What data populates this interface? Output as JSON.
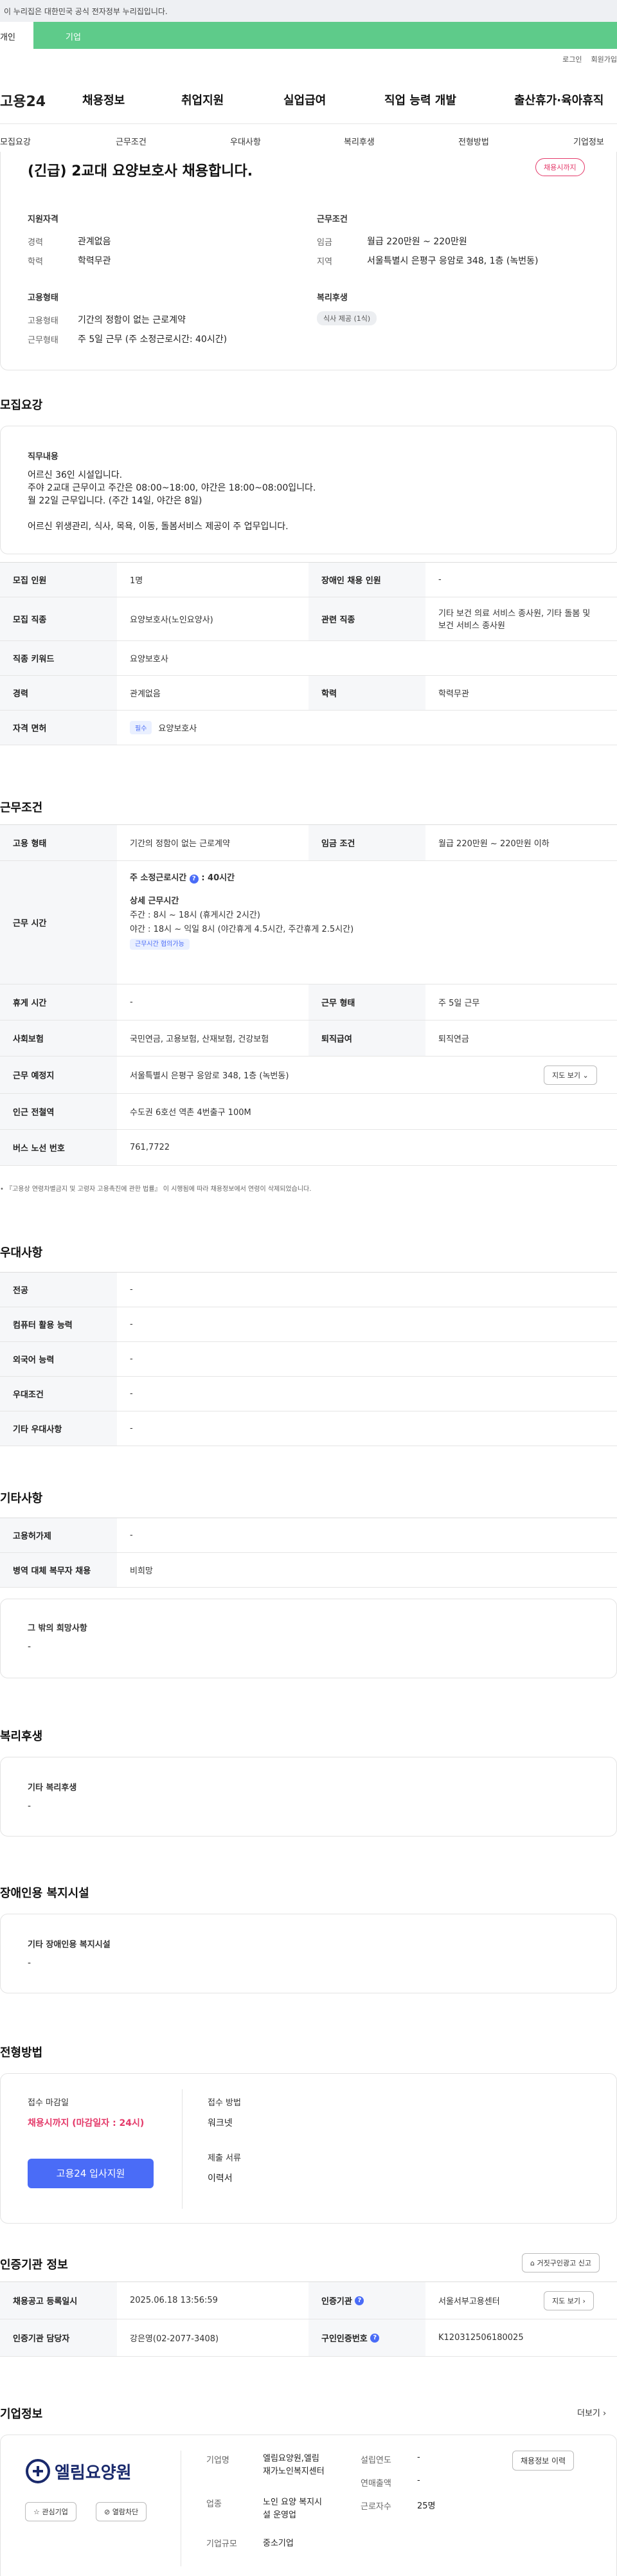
{
  "gov_banner": "이 누리집은 대한민국 공식 전자정부 누리집입니다.",
  "top_tabs": [
    "개인",
    "기업"
  ],
  "util": [
    "로그인",
    "회원가입"
  ],
  "logo": "고용24",
  "gnb": [
    "채용정보",
    "취업지원",
    "실업급여",
    "직업 능력 개발",
    "출산휴가·육아휴직"
  ],
  "subnav": [
    "모집요강",
    "근무조건",
    "우대사항",
    "복리후생",
    "전형방법",
    "기업정보"
  ],
  "summary": {
    "title": "(긴급) 2교대 요양보호사 채용합니다.",
    "deadline_badge": "채용시까지",
    "qual_title": "지원자격",
    "career_k": "경력",
    "career_v": "관계없음",
    "edu_k": "학력",
    "edu_v": "학력무관",
    "cond_title": "근무조건",
    "wage_k": "임금",
    "wage_v": "월급 220만원 ~ 220만원",
    "area_k": "지역",
    "area_v": "서울특별시 은평구 응암로 348, 1층 (녹번동)",
    "emp_title": "고용형태",
    "type_k": "고용형태",
    "type_v": "기간의 정함이 없는 근로계약",
    "work_k": "근무형태",
    "work_v": "주 5일 근무 (주 소정근로시간: 40시간)",
    "welfare_title": "복리후생",
    "welfare_tag": "식사 제공 (1식)"
  },
  "recruit": {
    "heading": "모집요강",
    "duty_title": "직무내용",
    "duty_lines": [
      "어르신 36인 시설입니다.",
      "주야 2교대 근무이고 주간은 08:00~18:00, 야간은 18:00~08:00입니다.",
      "월 22일 근무입니다. (주간 14일, 야간은 8일)",
      "",
      "어르신 위생관리, 식사, 목욕, 이동, 돌봄서비스 제공이 주 업무입니다."
    ],
    "count_k": "모집 인원",
    "count_v": "1명",
    "dis_k": "장애인 채용 인원",
    "dis_v": "-",
    "job_k": "모집 직종",
    "job_v": "요양보호사(노인요양사)",
    "rel_k": "관련 직종",
    "rel_v1": "기타 보건 의료 서비스 종사원, 기타 돌봄 및",
    "rel_v2": "보건 서비스 종사원",
    "kw_k": "직종 키워드",
    "kw_v": "요양보호사",
    "career_k": "경력",
    "career_v": "관계없음",
    "edu_k": "학력",
    "edu_v": "학력무관",
    "lic_k": "자격 면허",
    "lic_tag": "필수",
    "lic_v": "요양보호사"
  },
  "conditions": {
    "heading": "근무조건",
    "type_k": "고용 형태",
    "type_v": "기간의 정함이 없는 근로계약",
    "wage_k": "임금 조건",
    "wage_v": "월급 220만원 ~ 220만원 이하",
    "time_k": "근무 시간",
    "time_main_a": "주 소정근로시간",
    "time_main_b": ": 40시간",
    "detail_title": "상세 근무시간",
    "day": "주간 : 8시 ~ 18시 (휴게시간 2시간)",
    "night": "야간 : 18시 ~ 익일 8시 (야간휴게 4.5시간, 주간휴게 2.5시간)",
    "nego_tag": "근무시간 협의가능",
    "rest_k": "휴게 시간",
    "rest_v": "-",
    "form_k": "근무 형태",
    "form_v": "주 5일 근무",
    "ins_k": "사회보험",
    "ins_v": "국민연금, 고용보험, 산재보험, 건강보험",
    "ret_k": "퇴직급여",
    "ret_v": "퇴직연금",
    "place_k": "근무 예정지",
    "place_v": "서울특별시 은평구 응암로 348, 1층 (녹번동)",
    "map_btn": "지도 보기",
    "sub_k": "인근 전철역",
    "sub_v": "수도권 6호선 역촌 4번출구 100M",
    "bus_k": "버스 노선 번호",
    "bus_v": "761,7722",
    "note": "『고용상 연령차별금지 및 고령자 고용촉진에 관한 법률』 이 시행됨에 따라 채용정보에서 연령이 삭제되었습니다."
  },
  "pref": {
    "heading": "우대사항",
    "rows": [
      {
        "k": "전공",
        "v": "-"
      },
      {
        "k": "컴퓨터 활용 능력",
        "v": "-"
      },
      {
        "k": "외국어 능력",
        "v": "-"
      },
      {
        "k": "우대조건",
        "v": "-"
      },
      {
        "k": "기타 우대사항",
        "v": "-"
      }
    ]
  },
  "etc": {
    "heading": "기타사항",
    "rows": [
      {
        "k": "고용허가제",
        "v": "-"
      },
      {
        "k": "병역 대체 복무자 채용",
        "v": "비희망"
      }
    ],
    "hope_title": "그 밖의 희망사항",
    "hope_v": "-"
  },
  "welfare": {
    "heading": "복리후생",
    "box_title": "기타 복리후생",
    "box_v": "-"
  },
  "disab": {
    "heading": "장애인용 복지시설",
    "box_title": "기타 장애인용 복지시설",
    "box_v": "-"
  },
  "screen": {
    "heading": "전형방법",
    "close_k": "접수 마감일",
    "close_v": "채용시까지 (마감일자 : 24시)",
    "apply_btn": "고용24 입사지원",
    "method_k": "접수 방법",
    "method_v": "워크넷",
    "docs_k": "제출 서류",
    "docs_v": "이력서"
  },
  "agency": {
    "heading": "인증기관 정보",
    "report_btn": "거짓구인광고 신고",
    "reg_k": "채용공고 등록일시",
    "reg_v": "2025.06.18 13:56:59",
    "org_k": "인증기관",
    "org_v": "서울서부고용센터",
    "map_btn": "지도 보기",
    "mgr_k": "인증기관 담당자",
    "mgr_v": "강은영(02-2077-3408)",
    "num_k": "구인인증번호",
    "num_v": "K120312506180025"
  },
  "company": {
    "heading": "기업정보",
    "more": "더보기",
    "logo_text": "엘림요양원",
    "fav_btn": "관심기업",
    "block_btn": "열람차단",
    "name_k": "기업명",
    "name_v1": "엘림요양원,엘림",
    "name_v2": "재가노인복지센터",
    "ind_k": "업종",
    "ind_v1": "노인 요양 복지시",
    "ind_v2": "설 운영업",
    "size_k": "기업규모",
    "size_v": "중소기업",
    "year_k": "설립연도",
    "year_v": "-",
    "sales_k": "연매출액",
    "sales_v": "-",
    "emp_k": "근로자수",
    "emp_v": "25명",
    "jobs_btn": "채용정보 이력"
  }
}
